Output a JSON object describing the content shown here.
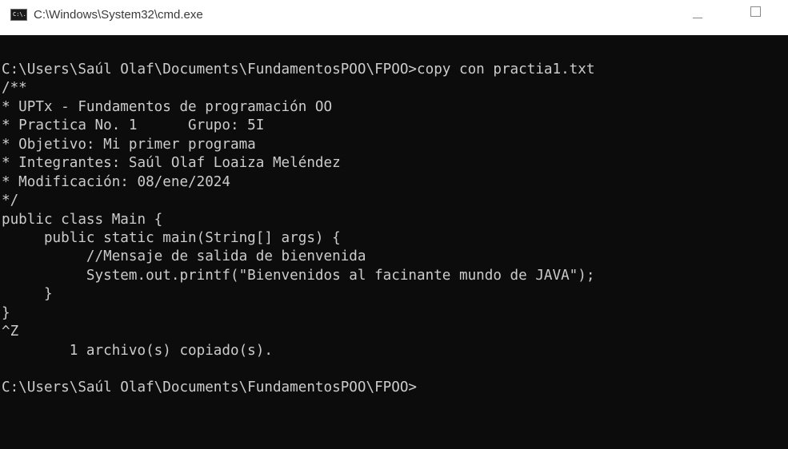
{
  "window": {
    "title": "C:\\Windows\\System32\\cmd.exe",
    "icon_name": "cmd-icon",
    "icon_text": "C:\\."
  },
  "controls": {
    "minimize_icon": "minimize-icon",
    "maximize_icon": "maximize-icon"
  },
  "console": {
    "lines": [
      "C:\\Users\\Saúl Olaf\\Documents\\FundamentosPOO\\FPOO>copy con practia1.txt",
      "/**",
      "* UPTx - Fundamentos de programación OO",
      "* Practica No. 1      Grupo: 5I",
      "* Objetivo: Mi primer programa",
      "* Integrantes: Saúl Olaf Loaiza Meléndez",
      "* Modificación: 08/ene/2024",
      "*/",
      "public class Main {",
      "     public static main(String[] args) {",
      "          //Mensaje de salida de bienvenida",
      "          System.out.printf(\"Bienvenidos al facinante mundo de JAVA\");",
      "     }",
      "}",
      "^Z",
      "        1 archivo(s) copiado(s).",
      "",
      "C:\\Users\\Saúl Olaf\\Documents\\FundamentosPOO\\FPOO>"
    ]
  },
  "colors": {
    "console_bg": "#0c0c0c",
    "console_fg": "#cccccc",
    "titlebar_bg": "#ffffff"
  }
}
